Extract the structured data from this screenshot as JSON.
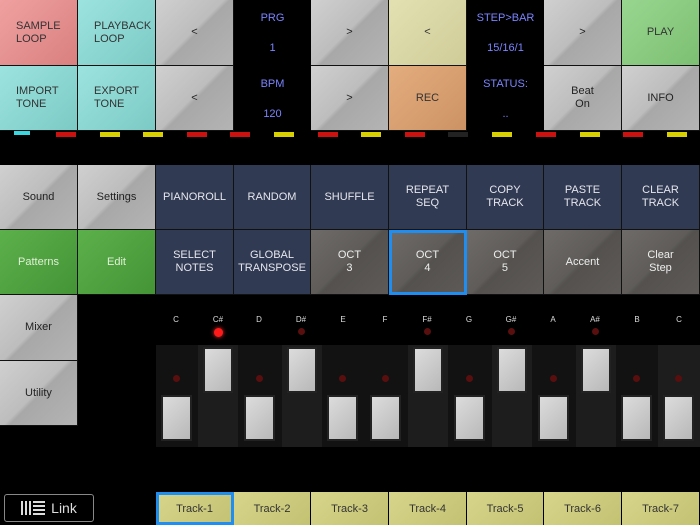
{
  "top_row1": {
    "sample_loop": "SAMPLE\nLOOP",
    "playback_loop": "PLAYBACK\nLOOP",
    "prg_prev": "<",
    "prg_label": "PRG",
    "prg_value": "1",
    "prg_next": ">",
    "step_prev": "<",
    "step_label": "STEP>BAR",
    "step_value": "15/16/1",
    "step_next": ">",
    "play": "PLAY"
  },
  "top_row2": {
    "import_tone": "IMPORT\nTONE",
    "export_tone": "EXPORT\nTONE",
    "bpm_prev": "<",
    "bpm_label": "BPM",
    "bpm_value": "120",
    "bpm_next": ">",
    "rec": "REC",
    "status_label": "STATUS:",
    "status_value": "..",
    "beat_on": "Beat\nOn",
    "info": "INFO"
  },
  "left_nav": {
    "sound": "Sound",
    "settings": "Settings",
    "patterns": "Patterns",
    "edit": "Edit",
    "mixer": "Mixer",
    "utility": "Utility"
  },
  "tools_row1": [
    "PIANOROLL",
    "RANDOM",
    "SHUFFLE",
    "REPEAT\nSEQ",
    "COPY\nTRACK",
    "PASTE\nTRACK",
    "CLEAR\nTRACK"
  ],
  "tools_row2": [
    "SELECT\nNOTES",
    "GLOBAL\nTRANSPOSE",
    "OCT\n3",
    "OCT\n4",
    "OCT\n5",
    "Accent",
    "Clear\nStep"
  ],
  "selected_octave": "OCT 4",
  "notes": [
    "C",
    "C#",
    "D",
    "D#",
    "E",
    "F",
    "F#",
    "G",
    "G#",
    "A",
    "A#",
    "B",
    "C"
  ],
  "active_note": "C#",
  "tracks": [
    "Track-1",
    "Track-2",
    "Track-3",
    "Track-4",
    "Track-5",
    "Track-6",
    "Track-7"
  ],
  "selected_track": "Track-1",
  "link_label": "Link",
  "colors": {
    "accent": "#1f8ef0",
    "led_on": "#ff1a1a",
    "indicator_red": "#cc1111",
    "indicator_yellow": "#d8d000"
  }
}
